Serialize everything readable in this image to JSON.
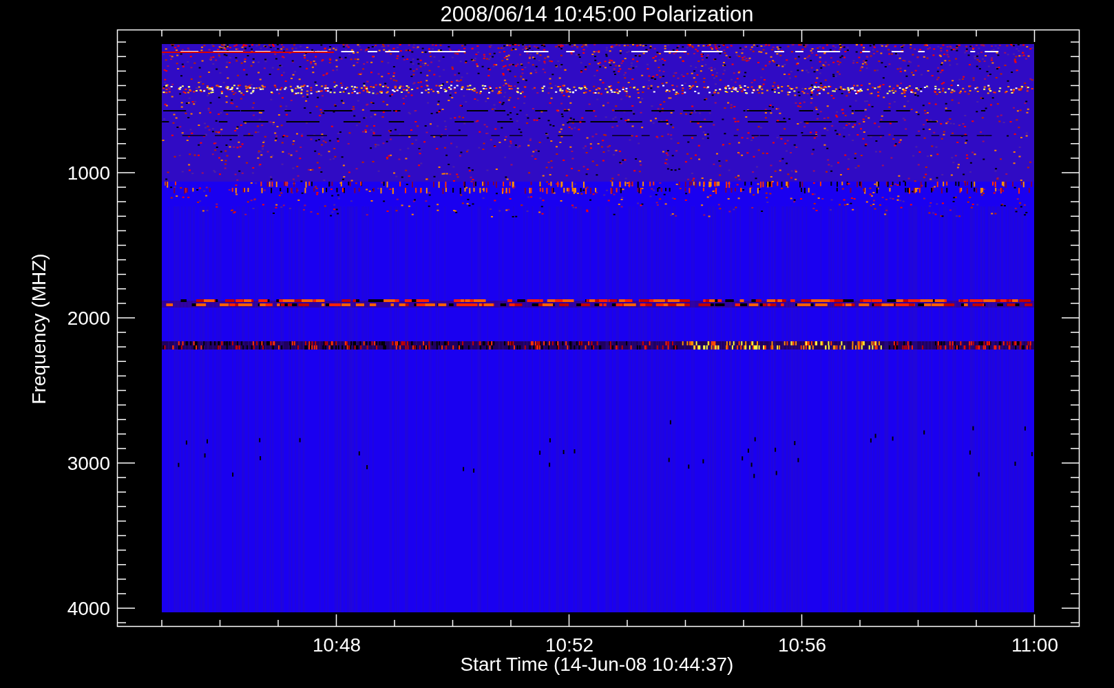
{
  "plot": {
    "title": "2008/06/14 10:45:00 Polarization",
    "ylabel": "Frequency (MHZ)",
    "xlabel": "Start Time (14-Jun-08 10:44:37)",
    "ytick_labels": [
      "1000",
      "2000",
      "3000",
      "4000"
    ],
    "xtick_labels": [
      "10:48",
      "10:52",
      "10:56",
      "11:00"
    ]
  }
}
